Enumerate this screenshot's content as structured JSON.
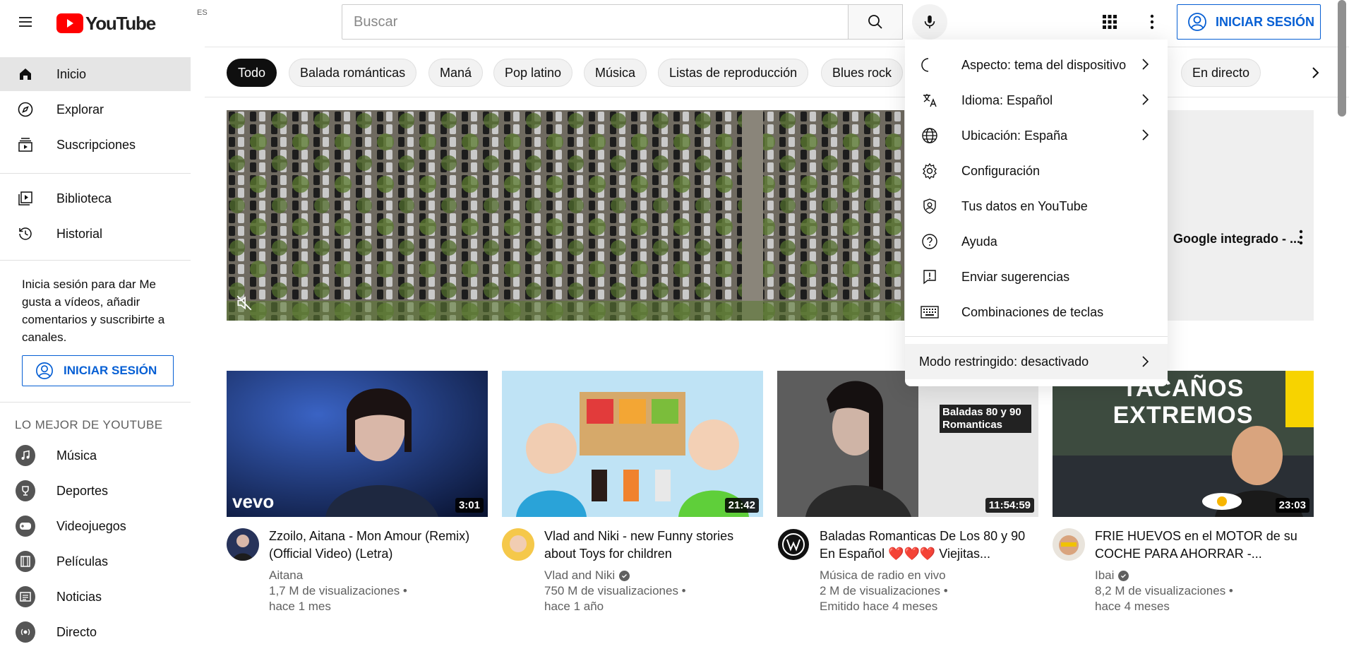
{
  "header": {
    "logo_text": "YouTube",
    "country_code": "ES",
    "search_placeholder": "Buscar",
    "signin_label": "INICIAR SESIÓN"
  },
  "sidebar": {
    "main": [
      {
        "label": "Inicio",
        "icon": "home-icon",
        "active": true
      },
      {
        "label": "Explorar",
        "icon": "compass-icon"
      },
      {
        "label": "Suscripciones",
        "icon": "subscriptions-icon"
      }
    ],
    "library": [
      {
        "label": "Biblioteca",
        "icon": "library-icon"
      },
      {
        "label": "Historial",
        "icon": "history-icon"
      }
    ],
    "signin_prompt": "Inicia sesión para dar Me gusta a vídeos, añadir comentarios y suscribirte a canales.",
    "signin_label": "INICIAR SESIÓN",
    "best_heading": "LO MEJOR DE YOUTUBE",
    "best": [
      {
        "label": "Música",
        "icon": "music-icon"
      },
      {
        "label": "Deportes",
        "icon": "trophy-icon"
      },
      {
        "label": "Videojuegos",
        "icon": "gamepad-icon"
      },
      {
        "label": "Películas",
        "icon": "film-icon"
      },
      {
        "label": "Noticias",
        "icon": "news-icon"
      },
      {
        "label": "Directo",
        "icon": "live-icon"
      }
    ]
  },
  "chips": [
    "Todo",
    "Balada románticas",
    "Maná",
    "Pop latino",
    "Música",
    "Listas de reproducción",
    "Blues rock",
    "En directo"
  ],
  "hero": {
    "ad_title": "Google integrado - ..."
  },
  "videos": [
    {
      "title": "Zzoilo, Aitana - Mon Amour (Remix)(Official Video) (Letra)",
      "channel": "Aitana",
      "verified": false,
      "views": "1,7 M de visualizaciones •",
      "age": "hace 1 mes",
      "duration": "3:01",
      "overlay": "vevo"
    },
    {
      "title": "Vlad and Niki - new Funny stories about Toys for children",
      "channel": "Vlad and Niki",
      "verified": true,
      "views": "750 M de visualizaciones •",
      "age": "hace 1 año",
      "duration": "21:42"
    },
    {
      "title": "Baladas Romanticas De Los 80 y 90 En Español ❤️❤️❤️ Viejitas...",
      "channel": "Música de radio en vivo",
      "verified": false,
      "views": "2 M de visualizaciones •",
      "age": "Emitido hace 4 meses",
      "duration": "11:54:59",
      "overlay": "Baladas 80 y 90 Romanticas"
    },
    {
      "title": "FRIE HUEVOS en el MOTOR de su COCHE PARA AHORRAR -...",
      "channel": "Ibai",
      "verified": true,
      "views": "8,2 M de visualizaciones •",
      "age": "hace 4 meses",
      "duration": "23:03",
      "overlay": "TACAÑOS EXTREMOS"
    }
  ],
  "menu": {
    "items": [
      {
        "label": "Aspecto: tema del dispositivo",
        "icon": "moon-icon",
        "chevron": true
      },
      {
        "label": "Idioma: Español",
        "icon": "translate-icon",
        "chevron": true
      },
      {
        "label": "Ubicación: España",
        "icon": "globe-icon",
        "chevron": true
      },
      {
        "label": "Configuración",
        "icon": "gear-icon"
      },
      {
        "label": "Tus datos en YouTube",
        "icon": "shield-user-icon"
      },
      {
        "label": "Ayuda",
        "icon": "help-icon"
      },
      {
        "label": "Enviar sugerencias",
        "icon": "feedback-icon"
      },
      {
        "label": "Combinaciones de teclas",
        "icon": "keyboard-icon"
      }
    ],
    "restricted": "Modo restringido: desactivado"
  },
  "colors": {
    "brand_red": "#ff0000",
    "link_blue": "#065fd4"
  }
}
